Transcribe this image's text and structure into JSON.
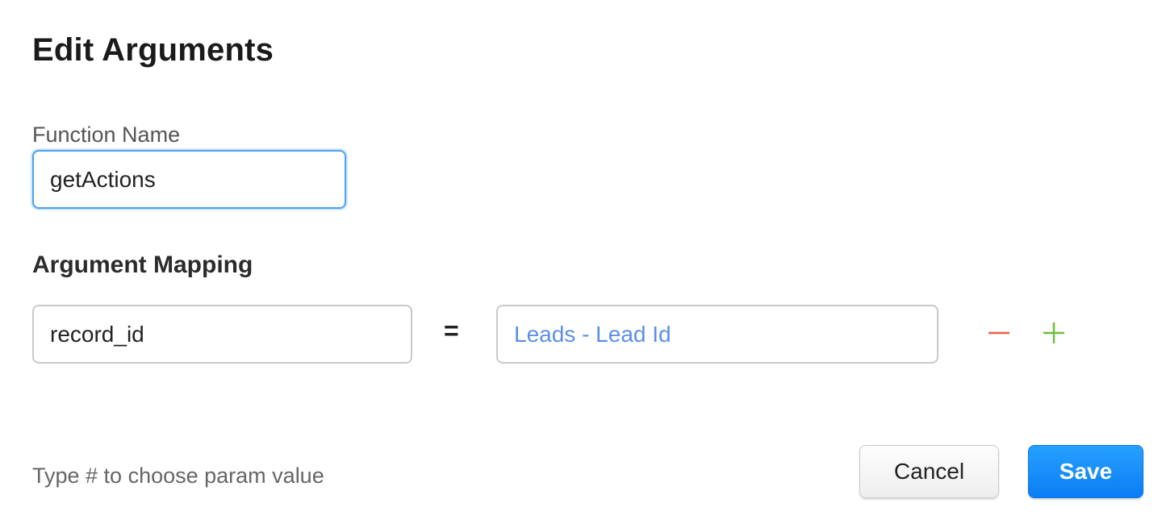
{
  "dialog": {
    "title": "Edit Arguments"
  },
  "function_name": {
    "label": "Function Name",
    "value": "getActions"
  },
  "argument_mapping": {
    "title": "Argument Mapping",
    "rows": [
      {
        "argument": "record_id",
        "operator": "=",
        "value": "Leads - Lead Id"
      }
    ]
  },
  "icons": {
    "remove": "minus-icon",
    "add": "plus-icon"
  },
  "colors": {
    "remove": "#e8604c",
    "add": "#6bbf3a",
    "value_text": "#5b8fe6",
    "primary": "#0a7ef5",
    "focus": "#4aa3f0"
  },
  "footer": {
    "hint": "Type # to choose param value",
    "cancel_label": "Cancel",
    "save_label": "Save"
  }
}
